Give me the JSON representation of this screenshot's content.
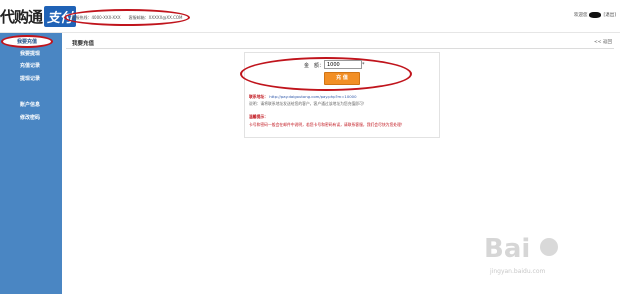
{
  "header": {
    "logo_text": "代购通",
    "logo_badge": "支付",
    "contact_phone": "客服热线：4000-XXX-XXX",
    "contact_email": "客服邮箱：XXXXX@XX.COM",
    "welcome": "欢迎您",
    "logout": "[退出]"
  },
  "sidebar": {
    "items": [
      {
        "label": "我要充值"
      },
      {
        "label": "我要提现"
      },
      {
        "label": "充值记录"
      },
      {
        "label": "提现记录"
      },
      {
        "label": "账户信息"
      },
      {
        "label": "修改密码"
      }
    ]
  },
  "main": {
    "title": "我要充值",
    "back": "<< 返回"
  },
  "form": {
    "amount_label": "金　额：",
    "amount_value": "1000",
    "unit": "*",
    "button": "充 值"
  },
  "info": {
    "addr_label": "联系地址：",
    "addr_url": "http://pay.daigoutong.com/pay.php?m=10000",
    "note": "说明：请将联系地址发送给您的客户，客户通过该地址为您充值即可！",
    "tip_title": "温馨提示：",
    "tip_text": "卡号和密码一般会在邮件中说明，若您卡号和密码有误，请联系客服，我们会尽快为您处理！"
  },
  "watermark": {
    "brand": "Bai",
    "sub": "jingyan.baidu.com"
  },
  "colors": {
    "sidebar": "#4a86c3",
    "accent_red": "#c0141c",
    "button": "#f28f25"
  }
}
